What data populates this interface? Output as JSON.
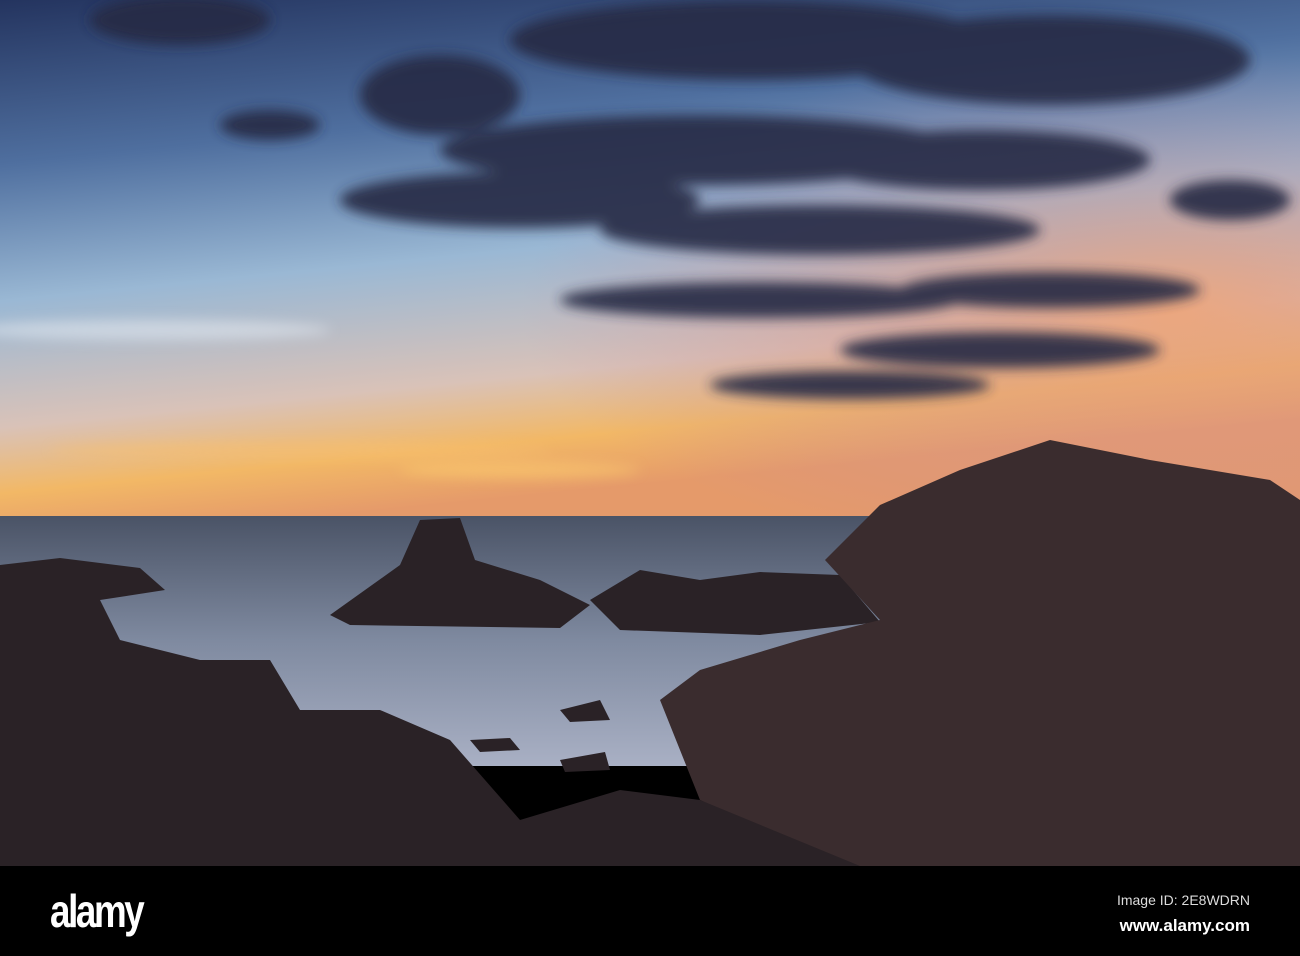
{
  "watermark": {
    "text": "alamy"
  },
  "footer": {
    "logo": "alamy",
    "image_id": "Image ID: 2E8WDRN",
    "website": "www.alamy.com"
  },
  "colors": {
    "sky_top": "#2c3b68",
    "sky_mid": "#8fb2d4",
    "horizon_glow": "#f3b766",
    "sea": "#5d6679",
    "rock": "#2a2226"
  }
}
